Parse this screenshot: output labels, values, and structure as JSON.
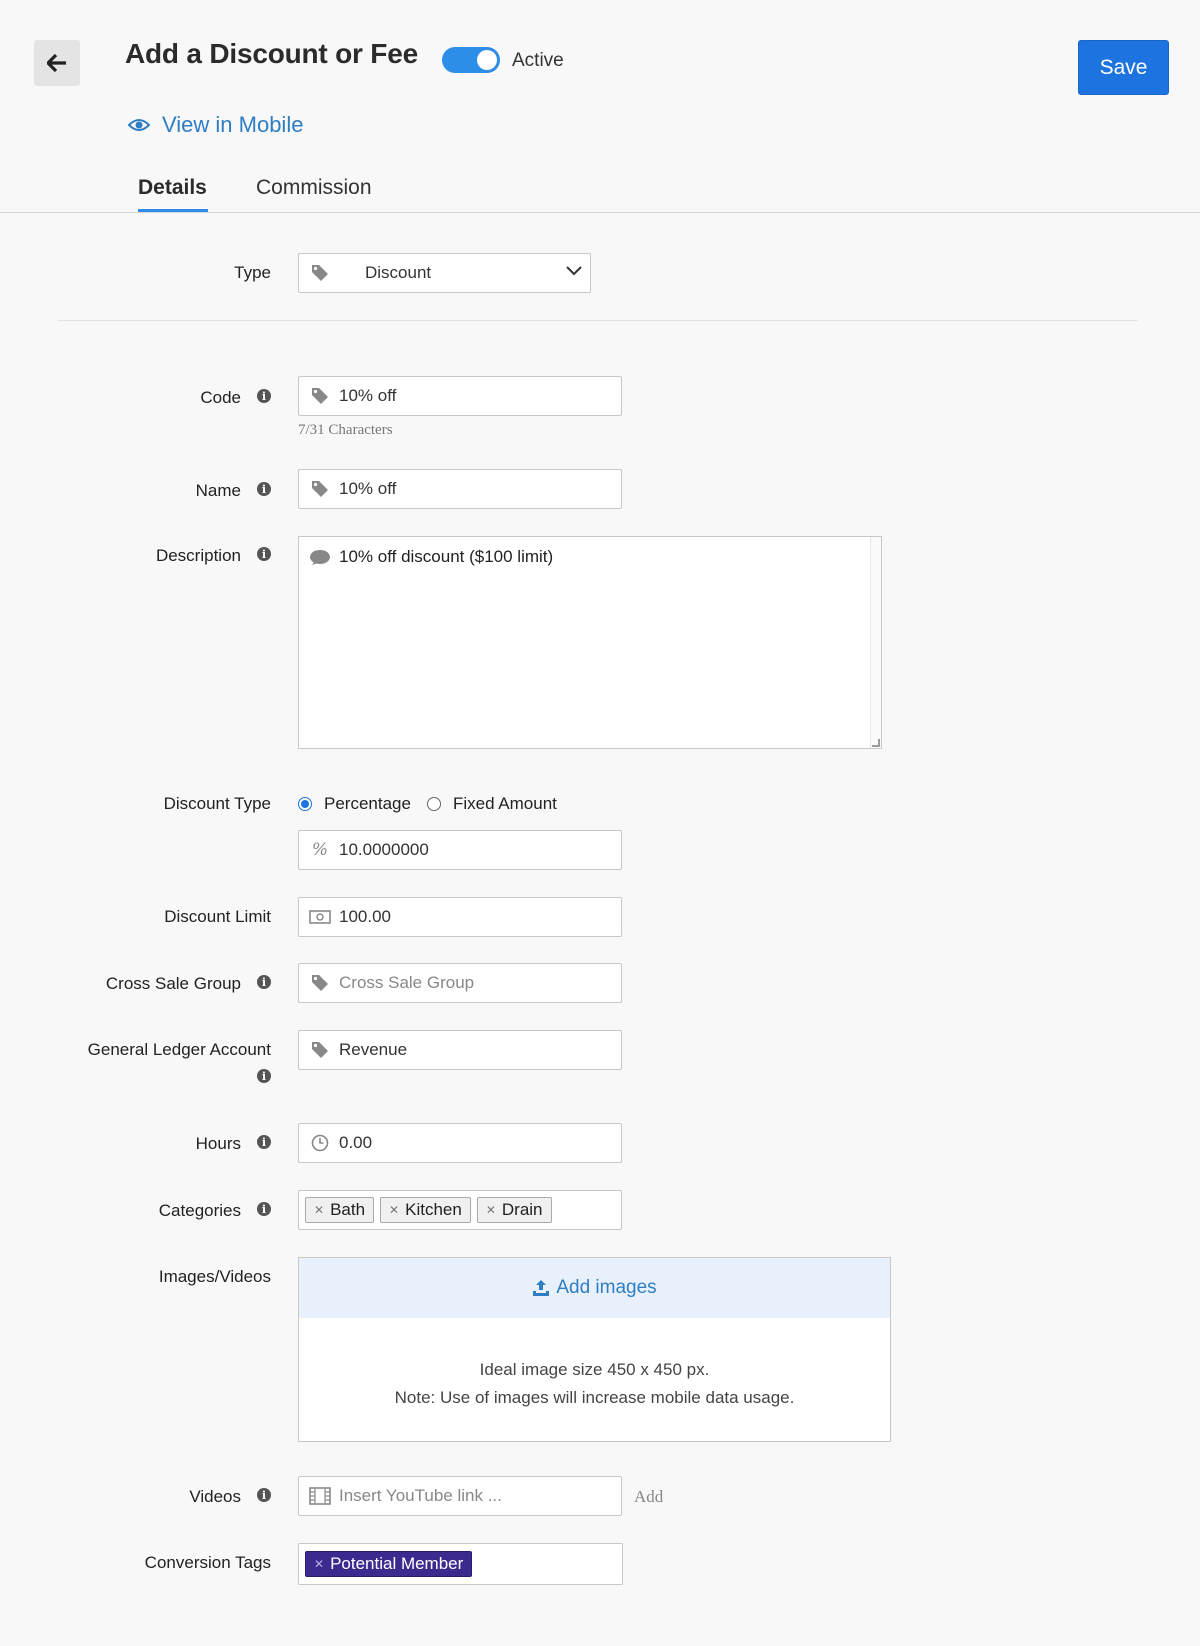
{
  "header": {
    "title": "Add a Discount or Fee",
    "active_label": "Active",
    "active": true,
    "save_label": "Save",
    "view_mobile": "View in Mobile"
  },
  "tabs": [
    {
      "label": "Details",
      "selected": true
    },
    {
      "label": "Commission",
      "selected": false
    }
  ],
  "form": {
    "type": {
      "label": "Type",
      "value": "Discount"
    },
    "code": {
      "label": "Code",
      "value": "10% off",
      "hint": "7/31 Characters"
    },
    "name": {
      "label": "Name",
      "value": "10% off"
    },
    "description": {
      "label": "Description",
      "value": "10% off discount ($100 limit)"
    },
    "discount_type": {
      "label": "Discount Type",
      "options": [
        "Percentage",
        "Fixed Amount"
      ],
      "selected": "Percentage",
      "value": "10.0000000"
    },
    "discount_limit": {
      "label": "Discount Limit",
      "value": "100.00"
    },
    "cross_sale_group": {
      "label": "Cross Sale Group",
      "placeholder": "Cross Sale Group"
    },
    "gl_account": {
      "label": "General Ledger Account",
      "value": "Revenue"
    },
    "hours": {
      "label": "Hours",
      "value": "0.00"
    },
    "categories": {
      "label": "Categories",
      "items": [
        "Bath",
        "Kitchen",
        "Drain"
      ]
    },
    "images": {
      "label": "Images/Videos",
      "add_label": "Add images",
      "note_line1": "Ideal image size 450 x 450 px.",
      "note_line2": "Note: Use of images will increase mobile data usage."
    },
    "videos": {
      "label": "Videos",
      "placeholder": "Insert YouTube link ...",
      "add_label": "Add"
    },
    "conversion_tags": {
      "label": "Conversion Tags",
      "items": [
        "Potential Member"
      ]
    }
  },
  "colors": {
    "accent": "#2d8ee8",
    "save": "#1d74e0",
    "link": "#2f7dc3",
    "tag_purple": "#3e2a8f"
  }
}
